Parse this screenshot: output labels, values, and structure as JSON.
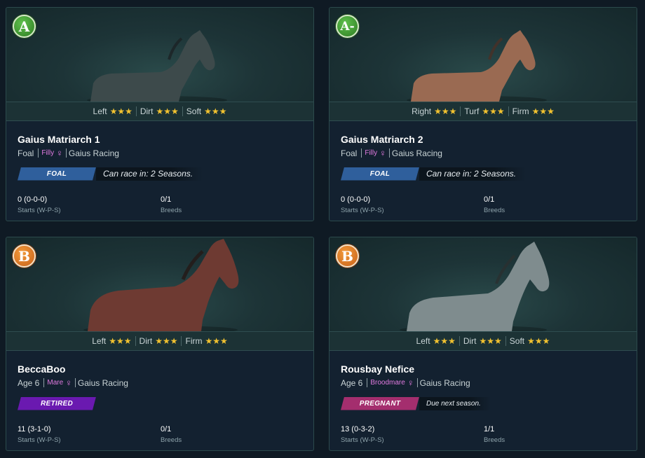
{
  "cards": [
    {
      "grade": "A",
      "grade_color": "#3f9a34",
      "surfaces": [
        {
          "label": "Left",
          "stars": "★★★"
        },
        {
          "label": "Dirt",
          "stars": "★★★"
        },
        {
          "label": "Soft",
          "stars": "★★★"
        }
      ],
      "name": "Gaius Matriarch 1",
      "age": "Foal",
      "sex": "Filly",
      "sex_icon": "♀",
      "stable": "Gaius Racing",
      "status": "FOAL",
      "status_color": "#2f5f9c",
      "status_note": "Can race in: 2 Seasons.",
      "record": "0 (0-0-0)",
      "record_label": "Starts (W-P-S)",
      "breeds": "0/1",
      "breeds_label": "Breeds",
      "horse_coat": "#3d4a4b"
    },
    {
      "grade": "A-",
      "grade_color": "#3f9a34",
      "surfaces": [
        {
          "label": "Right",
          "stars": "★★★"
        },
        {
          "label": "Turf",
          "stars": "★★★"
        },
        {
          "label": "Firm",
          "stars": "★★★"
        }
      ],
      "name": "Gaius Matriarch 2",
      "age": "Foal",
      "sex": "Filly",
      "sex_icon": "♀",
      "stable": "Gaius Racing",
      "status": "FOAL",
      "status_color": "#2f5f9c",
      "status_note": "Can race in: 2 Seasons.",
      "record": "0 (0-0-0)",
      "record_label": "Starts (W-P-S)",
      "breeds": "0/1",
      "breeds_label": "Breeds",
      "horse_coat": "#9a6a52"
    },
    {
      "grade": "B",
      "grade_color": "#d9731f",
      "surfaces": [
        {
          "label": "Left",
          "stars": "★★★"
        },
        {
          "label": "Dirt",
          "stars": "★★★"
        },
        {
          "label": "Firm",
          "stars": "★★★"
        }
      ],
      "name": "BeccaBoo",
      "age": "Age 6",
      "sex": "Mare",
      "sex_icon": "♀",
      "stable": "Gaius Racing",
      "status": "RETIRED",
      "status_color": "#6a19b0",
      "status_note": "",
      "record": "11 (3-1-0)",
      "record_label": "Starts (W-P-S)",
      "breeds": "0/1",
      "breeds_label": "Breeds",
      "horse_coat": "#6e3a32"
    },
    {
      "grade": "B",
      "grade_color": "#d9731f",
      "surfaces": [
        {
          "label": "Left",
          "stars": "★★★"
        },
        {
          "label": "Dirt",
          "stars": "★★★"
        },
        {
          "label": "Soft",
          "stars": "★★★"
        }
      ],
      "name": "Rousbay Nefice",
      "age": "Age 6",
      "sex": "Broodmare",
      "sex_icon": "♀",
      "stable": "Gaius Racing",
      "status": "PREGNANT",
      "status_color": "#a42e6e",
      "status_note": "Due next season.",
      "record": "13 (0-3-2)",
      "record_label": "Starts (W-P-S)",
      "breeds": "1/1",
      "breeds_label": "Breeds",
      "horse_coat": "#7f8c8e"
    }
  ]
}
